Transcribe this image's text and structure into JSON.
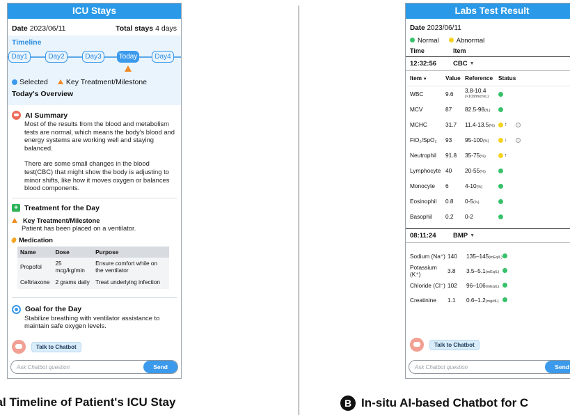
{
  "panel_a": {
    "title": "ICU Stays",
    "date_label": "Date",
    "date_value": "2023/06/11",
    "total_label": "Total stays",
    "total_value": "4 days",
    "timeline_label": "Timeline",
    "days": [
      "Day1",
      "Day2",
      "Day3",
      "Today",
      "Day4"
    ],
    "selected_day_index": 3,
    "legend_selected": "Selected",
    "legend_key": "Key Treatment/Milestone",
    "overview_title": "Today's Overview",
    "ai_summary_title": "AI Summary",
    "ai_summary_p1": "Most of the results from the blood and metabolism tests are normal, which means the body's blood and energy systems are working well and staying balanced.",
    "ai_summary_p2": "There are some small changes in the blood test(CBC) that might show the body is adjusting to minor shifts, like how it moves oxygen or balances blood components.",
    "treatment_title": "Treatment for the Day",
    "key_treatment_title": "Key Treatment/Milestone",
    "key_treatment_text": "Patient has been placed on a ventilator.",
    "medication_title": "Medication",
    "med_headers": [
      "Name",
      "Dose",
      "Purpose"
    ],
    "meds": [
      {
        "name": "Propofol",
        "dose": "25 mcg/kg/min",
        "purpose": "Ensure comfort while on the ventilator"
      },
      {
        "name": "Ceftriaxone",
        "dose": "2 grams daily",
        "purpose": "Treat underlying infection"
      }
    ],
    "goal_title": "Goal for the Day",
    "goal_text": "Stabilize breathing with ventilator assistance to maintain safe oxygen levels.",
    "talk_button": "Talk to Chatbot",
    "ask_placeholder": "Ask Chatbot question",
    "send_button": "Send"
  },
  "panel_b": {
    "title": "Labs Test Result",
    "date_label": "Date",
    "date_value": "2023/06/11",
    "legend_normal": "Normal",
    "legend_abnormal": "Abnormal",
    "col_time": "Time",
    "col_item": "Item",
    "cbc_time": "12:32:56",
    "cbc_item": "CBC",
    "lab_headers": [
      "Item",
      "Value",
      "Reference",
      "Status"
    ],
    "cbc_rows": [
      {
        "item": "WBC",
        "value": "9.6",
        "ref": "3.8-10.4",
        "unit": "(×103/microL)",
        "status": "normal",
        "arrow": ""
      },
      {
        "item": "MCV",
        "value": "87",
        "ref": "82.5-98",
        "unit": "(fL)",
        "status": "normal",
        "arrow": ""
      },
      {
        "item": "MCHC",
        "value": "31.7",
        "ref": "11.4-13.5",
        "unit": "(%)",
        "status": "abnormal",
        "arrow": "↑"
      },
      {
        "item": "FiO₂/SpO₂",
        "value": "93",
        "ref": "95-100",
        "unit": "(%)",
        "status": "abnormal",
        "arrow": "↓"
      },
      {
        "item": "Neutrophil",
        "value": "91.8",
        "ref": "35-75",
        "unit": "(%)",
        "status": "abnormal",
        "arrow": "↑"
      },
      {
        "item": "Lymphocyte",
        "value": "40",
        "ref": "20-55",
        "unit": "(%)",
        "status": "normal",
        "arrow": ""
      },
      {
        "item": "Monocyte",
        "value": "6",
        "ref": "4-10",
        "unit": "(%)",
        "status": "normal",
        "arrow": ""
      },
      {
        "item": "Eosinophil",
        "value": "0.8",
        "ref": "0-5",
        "unit": "(%)",
        "status": "normal",
        "arrow": ""
      },
      {
        "item": "Basophil",
        "value": "0.2",
        "ref": "0-2",
        "unit": "",
        "status": "normal",
        "arrow": ""
      }
    ],
    "bmp_time": "08:11:24",
    "bmp_item": "BMP",
    "bmp_rows": [
      {
        "item": "Sodium (Na⁺)",
        "value": "140",
        "ref": "135–145",
        "unit": "(mEq/L)",
        "status": "normal"
      },
      {
        "item": "Potassium (K⁺)",
        "value": "3.8",
        "ref": "3.5–5.1",
        "unit": "(mEq/L)",
        "status": "normal"
      },
      {
        "item": "Chloride (Cl⁻)",
        "value": "102",
        "ref": "96–106",
        "unit": "(mEq/L)",
        "status": "normal"
      },
      {
        "item": "Creatinine",
        "value": "1.1",
        "ref": "0.6–1.2",
        "unit": "(mg/dL)",
        "status": "normal"
      }
    ],
    "talk_button": "Talk to Chatbot",
    "ask_placeholder": "Ask Chatbot question",
    "send_button": "Send"
  },
  "captions": {
    "a": "dical Timeline of Patient's ICU Stay",
    "b_letter": "B",
    "b": "In-situ AI-based Chatbot for C"
  },
  "colors": {
    "brand_blue": "#2a9ae8",
    "milestone_orange": "#f08a24",
    "normal_green": "#37c16a",
    "abnormal_yellow": "#f5d21d"
  }
}
